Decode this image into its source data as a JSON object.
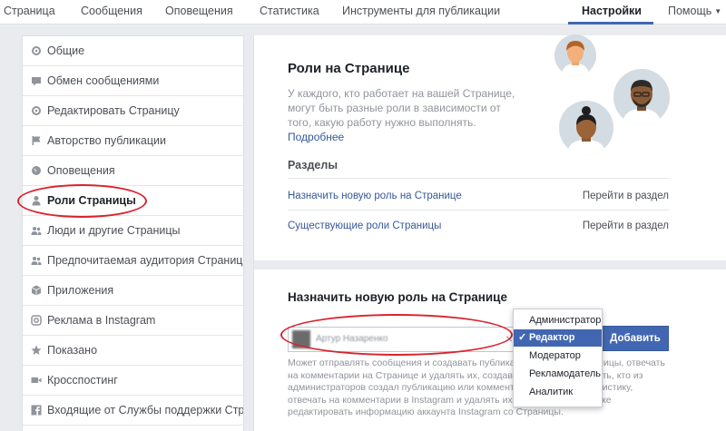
{
  "topnav": {
    "items": [
      "Страница",
      "Сообщения",
      "Оповещения",
      "Статистика",
      "Инструменты для публикации"
    ],
    "settings": "Настройки",
    "help": "Помощь",
    "help_caret": "▼"
  },
  "sidebar": {
    "items": [
      {
        "label": "Общие",
        "icon": "gear-icon"
      },
      {
        "label": "Обмен сообщениями",
        "icon": "chat-icon"
      },
      {
        "label": "Редактировать Страницу",
        "icon": "gear-icon"
      },
      {
        "label": "Авторство публикации",
        "icon": "flag-icon"
      },
      {
        "label": "Оповещения",
        "icon": "globe-icon"
      },
      {
        "label": "Роли Страницы",
        "icon": "person-icon"
      },
      {
        "label": "Люди и другие Страницы",
        "icon": "people-icon"
      },
      {
        "label": "Предпочитаемая аудитория Страницы",
        "icon": "people-icon"
      },
      {
        "label": "Приложения",
        "icon": "cube-icon"
      },
      {
        "label": "Реклама в Instagram",
        "icon": "instagram-icon"
      },
      {
        "label": "Показано",
        "icon": "star-icon"
      },
      {
        "label": "Кросспостинг",
        "icon": "video-icon"
      },
      {
        "label": "Входящие от Службы поддержки Страни",
        "icon": "facebook-icon"
      }
    ],
    "active_index": 5
  },
  "hero": {
    "title": "Роли на Странице",
    "desc": "У каждого, кто работает на вашей Странице, могут быть разные роли в зависимости от того, какую работу нужно выполнять. ",
    "more_link": "Подробнее"
  },
  "sections": {
    "title": "Разделы",
    "rows": [
      {
        "label": "Назначить новую роль на Странице",
        "go": "Перейти в раздел"
      },
      {
        "label": "Существующие роли Страницы",
        "go": "Перейти в раздел"
      }
    ]
  },
  "assign": {
    "title": "Назначить новую роль на Странице",
    "input_value": "Артур Назаренко",
    "clear": "×",
    "add_button": "Добавить",
    "help_text": "Может отправлять сообщения и создавать публикации от имени Страницы, отвечать на комментарии на Странице и удалять их, создавать рекламу, смотреть, кто из администраторов создал публикацию или комментарий, смотреть статистику, отвечать на комментарии в Instagram и удалять их со Страницы, а также редактировать информацию аккаунта Instagram со Страницы."
  },
  "role_dropdown": {
    "options": [
      "Администратор",
      "Редактор",
      "Модератор",
      "Рекламодатель",
      "Аналитик"
    ],
    "selected_index": 1,
    "check": "✓"
  },
  "colors": {
    "accent": "#4267b2",
    "link": "#365899",
    "highlight_ring": "#d9232e"
  }
}
